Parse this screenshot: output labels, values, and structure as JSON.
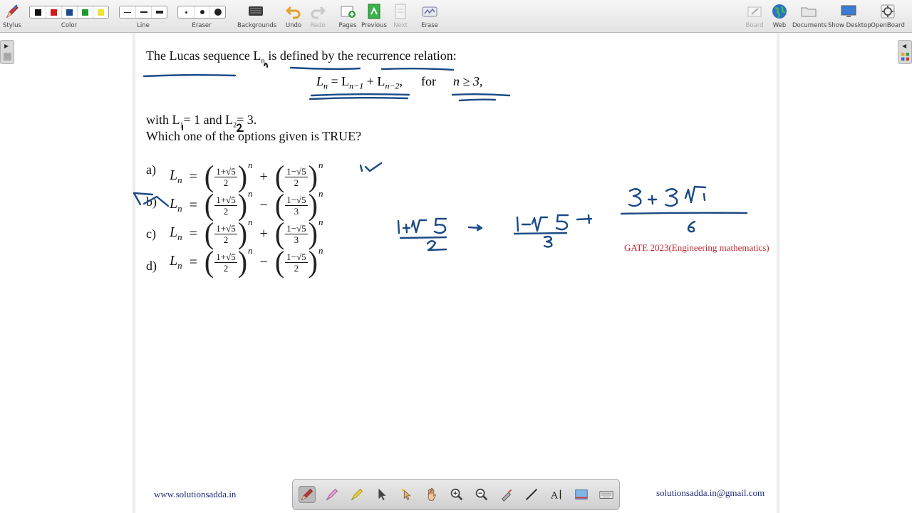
{
  "toolbar": {
    "stylus": "Stylus",
    "color": "Color",
    "line": "Line",
    "eraser": "Eraser",
    "backgrounds": "Backgrounds",
    "undo": "Undo",
    "redo": "Redo",
    "pages": "Pages",
    "previous": "Previous",
    "next": "Next",
    "erase": "Erase",
    "board": "Board",
    "web": "Web",
    "documents": "Documents",
    "show_desktop": "Show Desktop",
    "openboard": "OpenBoard",
    "colors": [
      "#111111",
      "#d11a1a",
      "#1a4a8a",
      "#1f9a2a",
      "#f2e23a"
    ]
  },
  "page": {
    "intro_text": "The Lucas sequence L",
    "intro_sub": "n",
    "intro_rest": " is defined by the recurrence relation:",
    "formula_lhs": "L",
    "formula_lhs_sub": "n",
    "formula_eq": " = L",
    "formula_t1_sub": "n−1",
    "formula_plus": " + L",
    "formula_t2_sub": "n−2",
    "formula_comma": ",",
    "formula_for": "for",
    "formula_cond": "n ≥ 3,",
    "with_text": "with L",
    "with_sub1": "1",
    "with_mid": "= 1 and L",
    "with_sub2": "2",
    "with_end": "= 3.",
    "question": "Which one of the options given is TRUE?",
    "options": [
      {
        "label": "a)",
        "num1": "1+√5",
        "den1": "2",
        "op": "+",
        "num2": "1−√5",
        "den2": "2"
      },
      {
        "label": "b)",
        "num1": "1+√5",
        "den1": "2",
        "op": "−",
        "num2": "1−√5",
        "den2": "3"
      },
      {
        "label": "c)",
        "num1": "1+√5",
        "den1": "2",
        "op": "+",
        "num2": "1−√5",
        "den2": "3"
      },
      {
        "label": "d)",
        "num1": "1+√5",
        "den1": "2",
        "op": "−",
        "num2": "1−√5",
        "den2": "2"
      }
    ],
    "Ln": "L",
    "n": "n",
    "eq_sign": "=",
    "gate_note": "GATE 2023(Engineering mathematics)",
    "footer_left": "www.solutionsadda.in",
    "footer_right": "solutionsadda.in@gmail.com"
  },
  "ink_color": "#1b4a86",
  "palette_tools": [
    "pen-icon",
    "highlighter-icon",
    "marker-icon",
    "pointer-icon",
    "laser-pointer-icon",
    "hand-icon",
    "zoom-in-icon",
    "zoom-out-icon",
    "capture-icon",
    "line-icon",
    "text-icon",
    "screenshot-icon",
    "keyboard-icon"
  ]
}
